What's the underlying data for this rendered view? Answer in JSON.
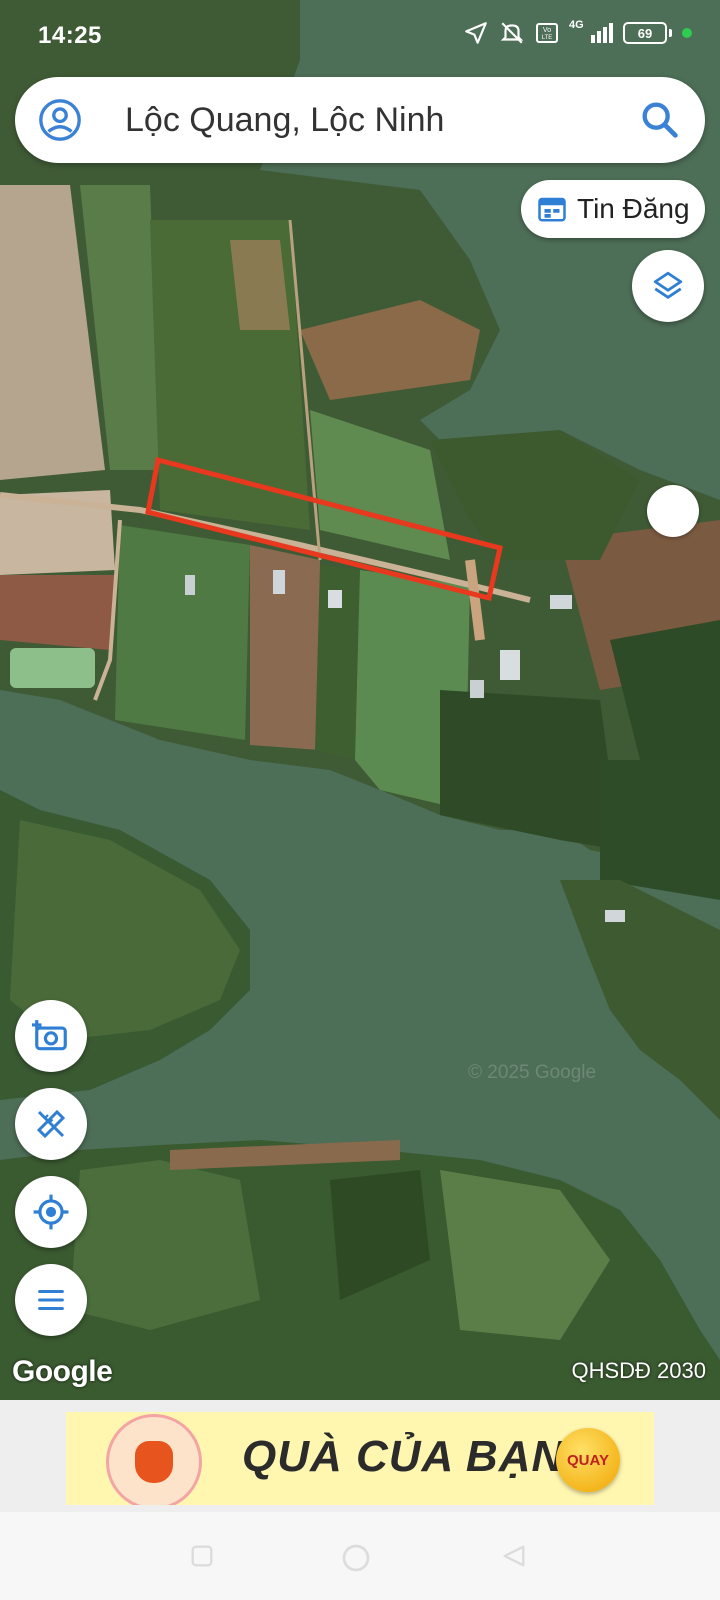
{
  "status_bar": {
    "time": "14:25",
    "battery": "69",
    "network": "4G"
  },
  "search": {
    "query": "Lộc Quang, Lộc Ninh"
  },
  "tin_dang": {
    "label": "Tin Đăng"
  },
  "map": {
    "provider_logo": "Google",
    "plan_label": "QHSDĐ 2030",
    "copyright": "© 2025 Google",
    "highlight_color": "#e8381e"
  },
  "banner": {
    "text": "QUÀ CỦA BẠN",
    "button": "QUAY"
  },
  "icons": [
    "profile-icon",
    "search-icon",
    "calendar-icon",
    "layers-icon",
    "add-photo-icon",
    "measure-icon",
    "my-location-icon",
    "menu-icon"
  ]
}
